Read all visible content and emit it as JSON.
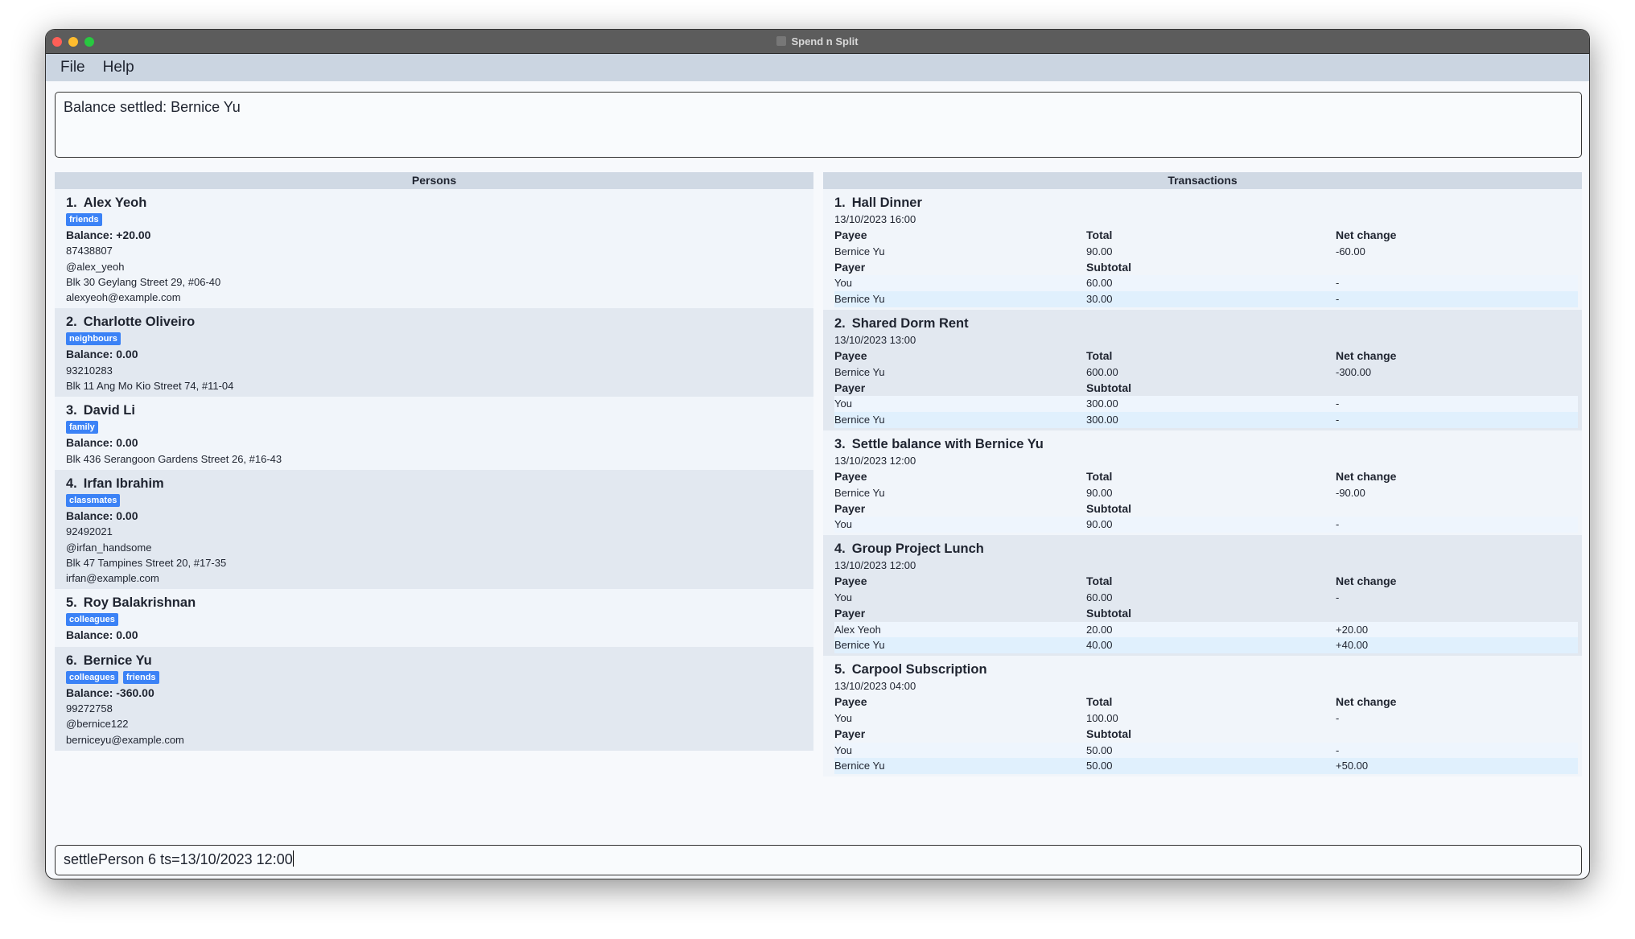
{
  "window": {
    "title": "Spend n Split",
    "traffic_lights": {
      "close": "#fe5f57",
      "minimize": "#febc2e",
      "maximize": "#28c840"
    }
  },
  "menu": [
    "File",
    "Help"
  ],
  "result_text": "Balance settled: Bernice Yu",
  "persons": {
    "header": "Persons",
    "items": [
      {
        "index": "1.",
        "name": "Alex Yeoh",
        "tags": [
          "friends"
        ],
        "balance": "Balance: +20.00",
        "details": [
          "87438807",
          "@alex_yeoh",
          "Blk 30 Geylang Street 29, #06-40",
          "alexyeoh@example.com"
        ]
      },
      {
        "index": "2.",
        "name": "Charlotte Oliveiro",
        "tags": [
          "neighbours"
        ],
        "balance": "Balance: 0.00",
        "details": [
          "93210283",
          "Blk 11 Ang Mo Kio Street 74, #11-04"
        ]
      },
      {
        "index": "3.",
        "name": "David Li",
        "tags": [
          "family"
        ],
        "balance": "Balance: 0.00",
        "details": [
          "Blk 436 Serangoon Gardens Street 26, #16-43"
        ]
      },
      {
        "index": "4.",
        "name": "Irfan Ibrahim",
        "tags": [
          "classmates"
        ],
        "balance": "Balance: 0.00",
        "details": [
          "92492021",
          "@irfan_handsome",
          "Blk 47 Tampines Street 20, #17-35",
          "irfan@example.com"
        ]
      },
      {
        "index": "5.",
        "name": "Roy Balakrishnan",
        "tags": [
          "colleagues"
        ],
        "balance": "Balance: 0.00",
        "details": []
      },
      {
        "index": "6.",
        "name": "Bernice Yu",
        "tags": [
          "colleagues",
          "friends"
        ],
        "balance": "Balance: -360.00",
        "details": [
          "99272758",
          "@bernice122",
          "berniceyu@example.com"
        ]
      }
    ]
  },
  "transactions": {
    "header": "Transactions",
    "col_labels": {
      "payee": "Payee",
      "total": "Total",
      "net": "Net change",
      "payer": "Payer",
      "subtotal": "Subtotal"
    },
    "items": [
      {
        "index": "1.",
        "title": "Hall Dinner",
        "date": "13/10/2023 16:00",
        "payee": "Bernice Yu",
        "total": "90.00",
        "net": "-60.00",
        "payers": [
          {
            "name": "You",
            "subtotal": "60.00",
            "net": "-"
          },
          {
            "name": "Bernice Yu",
            "subtotal": "30.00",
            "net": "-"
          }
        ]
      },
      {
        "index": "2.",
        "title": "Shared Dorm Rent",
        "date": "13/10/2023 13:00",
        "payee": "Bernice Yu",
        "total": "600.00",
        "net": "-300.00",
        "payers": [
          {
            "name": "You",
            "subtotal": "300.00",
            "net": "-"
          },
          {
            "name": "Bernice Yu",
            "subtotal": "300.00",
            "net": "-"
          }
        ]
      },
      {
        "index": "3.",
        "title": "Settle balance with Bernice Yu",
        "date": "13/10/2023 12:00",
        "payee": "Bernice Yu",
        "total": "90.00",
        "net": "-90.00",
        "payers": [
          {
            "name": "You",
            "subtotal": "90.00",
            "net": "-"
          }
        ]
      },
      {
        "index": "4.",
        "title": "Group Project Lunch",
        "date": "13/10/2023 12:00",
        "payee": "You",
        "total": "60.00",
        "net": "-",
        "payers": [
          {
            "name": "Alex Yeoh",
            "subtotal": "20.00",
            "net": "+20.00"
          },
          {
            "name": "Bernice Yu",
            "subtotal": "40.00",
            "net": "+40.00"
          }
        ]
      },
      {
        "index": "5.",
        "title": "Carpool Subscription",
        "date": "13/10/2023 04:00",
        "payee": "You",
        "total": "100.00",
        "net": "-",
        "payers": [
          {
            "name": "You",
            "subtotal": "50.00",
            "net": "-"
          },
          {
            "name": "Bernice Yu",
            "subtotal": "50.00",
            "net": "+50.00"
          }
        ]
      }
    ]
  },
  "command": {
    "value": "settlePerson 6 ts=13/10/2023 12:00"
  },
  "colors": {
    "tag": "#3b82f6",
    "menubar": "#cbd5e1",
    "panel_header": "#d0d9e4"
  }
}
